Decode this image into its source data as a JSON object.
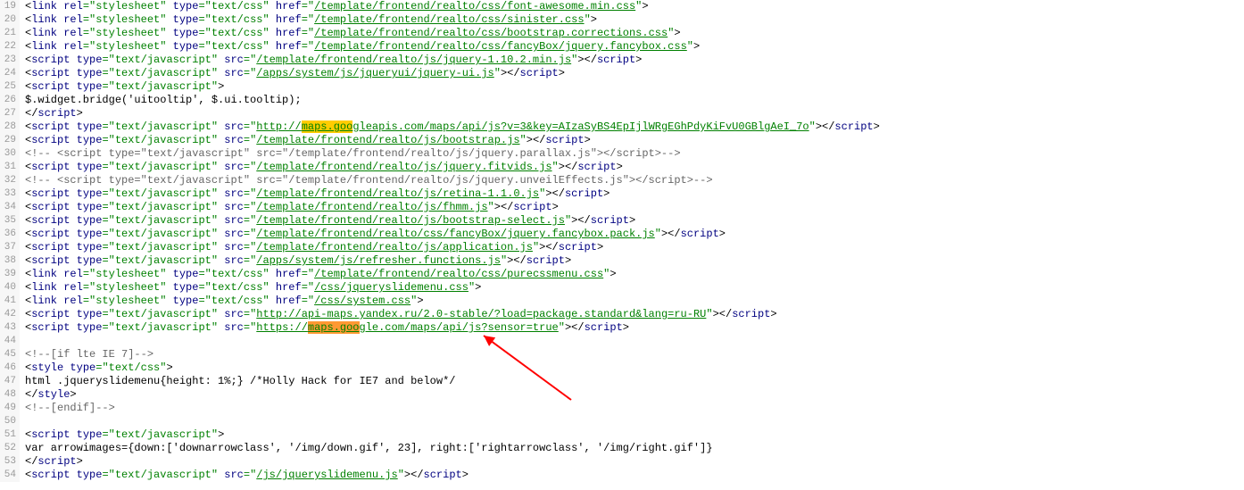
{
  "highlight_text": "maps.goo",
  "lines": [
    {
      "n": 19,
      "ind": 1,
      "t": "link",
      "href": "/template/frontend/realto/css/font-awesome.min.css"
    },
    {
      "n": 20,
      "ind": 1,
      "t": "link",
      "href": "/template/frontend/realto/css/sinister.css"
    },
    {
      "n": 21,
      "ind": 1,
      "t": "link",
      "href": "/template/frontend/realto/css/bootstrap.corrections.css"
    },
    {
      "n": 22,
      "ind": 1,
      "t": "link",
      "href": "/template/frontend/realto/css/fancyBox/jquery.fancybox.css"
    },
    {
      "n": 23,
      "ind": 2,
      "t": "script",
      "src": "/template/frontend/realto/js/jquery-1.10.2.min.js"
    },
    {
      "n": 24,
      "ind": 2,
      "t": "script",
      "src": "/apps/system/js/jqueryui/jquery-ui.js"
    },
    {
      "n": 25,
      "ind": 0,
      "t": "raw",
      "raw": "<script type=\"text/javascript\">"
    },
    {
      "n": 26,
      "ind": 0,
      "t": "plain",
      "txt": "$.widget.bridge('uitooltip', $.ui.tooltip);"
    },
    {
      "n": 27,
      "ind": 0,
      "t": "close_script"
    },
    {
      "n": 28,
      "ind": 1,
      "t": "script_hl",
      "pre": "http://",
      "hl": "maps.goo",
      "post": "gleapis.com/maps/api/js?v=3&key=AIzaSyBS4EpIjlWRgEGhPdyKiFvU0GBlgAeI_7o",
      "hlclass": "hl"
    },
    {
      "n": 29,
      "ind": 2,
      "t": "script",
      "src": "/template/frontend/realto/js/bootstrap.js"
    },
    {
      "n": 30,
      "ind": 2,
      "t": "comment",
      "txt": "<!--  <script type=\"text/javascript\" src=\"/template/frontend/realto/js/jquery.parallax.js\"></script>-->"
    },
    {
      "n": 31,
      "ind": 2,
      "t": "script",
      "src": "/template/frontend/realto/js/jquery.fitvids.js"
    },
    {
      "n": 32,
      "ind": 2,
      "t": "comment",
      "txt": "<!--  <script type=\"text/javascript\" src=\"/template/frontend/realto/js/jquery.unveilEffects.js\"></script>-->"
    },
    {
      "n": 33,
      "ind": 2,
      "t": "script",
      "src": "/template/frontend/realto/js/retina-1.1.0.js"
    },
    {
      "n": 34,
      "ind": 2,
      "t": "script",
      "src": "/template/frontend/realto/js/fhmm.js"
    },
    {
      "n": 35,
      "ind": 2,
      "t": "script",
      "src": "/template/frontend/realto/js/bootstrap-select.js"
    },
    {
      "n": 36,
      "ind": 2,
      "t": "script",
      "src": "/template/frontend/realto/css/fancyBox/jquery.fancybox.pack.js"
    },
    {
      "n": 37,
      "ind": 2,
      "t": "script",
      "src": "/template/frontend/realto/js/application.js"
    },
    {
      "n": 38,
      "ind": 0,
      "t": "script",
      "src": "/apps/system/js/refresher.functions.js"
    },
    {
      "n": 39,
      "ind": 0,
      "t": "link",
      "href": "/template/frontend/realto/css/purecssmenu.css"
    },
    {
      "n": 40,
      "ind": 0,
      "t": "link",
      "href": "/css/jqueryslidemenu.css"
    },
    {
      "n": 41,
      "ind": 0,
      "t": "link",
      "href": "/css/system.css"
    },
    {
      "n": 42,
      "ind": 0,
      "t": "script",
      "src": "http://api-maps.yandex.ru/2.0-stable/?load=package.standard&lang=ru-RU"
    },
    {
      "n": 43,
      "ind": 0,
      "t": "script_hl",
      "pre": "https://",
      "hl": "maps.goo",
      "post": "gle.com/maps/api/js?sensor=true",
      "hlclass": "hl2"
    },
    {
      "n": 44,
      "ind": 0,
      "t": "empty"
    },
    {
      "n": 45,
      "ind": 0,
      "t": "comment",
      "txt": "<!--[if lte IE 7]-->"
    },
    {
      "n": 46,
      "ind": 0,
      "t": "raw",
      "raw": "<style type=\"text/css\">"
    },
    {
      "n": 47,
      "ind": 0,
      "t": "plain",
      "txt": "html .jqueryslidemenu{height: 1%;} /*Holly Hack for IE7 and below*/"
    },
    {
      "n": 48,
      "ind": 0,
      "t": "raw",
      "raw": "</style>"
    },
    {
      "n": 49,
      "ind": 0,
      "t": "comment",
      "txt": "<!--[endif]-->"
    },
    {
      "n": 50,
      "ind": 0,
      "t": "empty"
    },
    {
      "n": 51,
      "ind": 0,
      "t": "raw",
      "raw": "<script type=\"text/javascript\">"
    },
    {
      "n": 52,
      "ind": 0,
      "t": "plain",
      "txt": "var arrowimages={down:['downarrowclass', '/img/down.gif', 23], right:['rightarrowclass', '/img/right.gif']}"
    },
    {
      "n": 53,
      "ind": 0,
      "t": "close_script"
    },
    {
      "n": 54,
      "ind": 0,
      "t": "script",
      "src": "/js/jqueryslidemenu.js"
    }
  ],
  "strings": {
    "link_open": "<link",
    "rel_attr": "rel",
    "stylesheet": "stylesheet",
    "type_attr": "type",
    "textcss": "text/css",
    "href_attr": "href",
    "tag_close_self": ">",
    "tag_close": ">",
    "script_open": "<script",
    "textjs": "text/javascript",
    "src_attr": "src",
    "script_close": "</script>",
    "angle_open": "<",
    "angle_close": ">",
    "slash": "/",
    "eq_quote": "=\"",
    "quote": "\""
  }
}
